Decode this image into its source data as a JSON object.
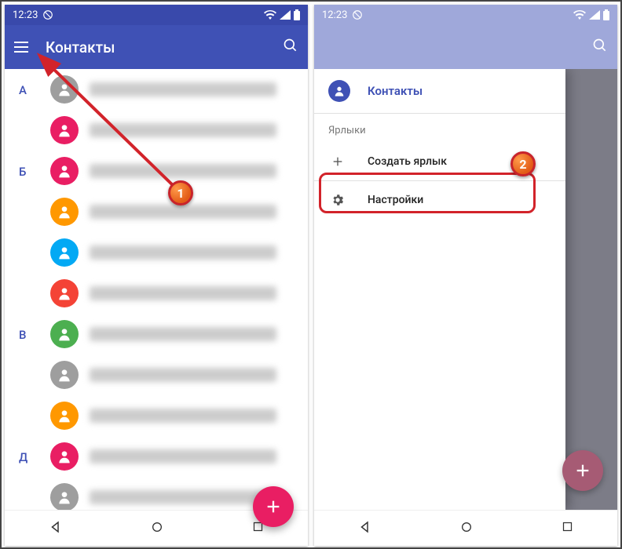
{
  "statusbar": {
    "time": "12:23"
  },
  "phone1": {
    "appbar": {
      "title": "Контакты"
    },
    "sections": [
      {
        "letter": "А",
        "rows": [
          {
            "color": "#9e9e9e"
          },
          {
            "color": "#e91e63"
          }
        ]
      },
      {
        "letter": "Б",
        "rows": [
          {
            "color": "#e91e63"
          },
          {
            "color": "#ff9800"
          },
          {
            "color": "#03a9f4"
          },
          {
            "color": "#f44336"
          }
        ]
      },
      {
        "letter": "В",
        "rows": [
          {
            "color": "#4caf50"
          },
          {
            "color": "#9e9e9e"
          },
          {
            "color": "#ff9800"
          }
        ]
      },
      {
        "letter": "Д",
        "rows": [
          {
            "color": "#e91e63"
          },
          {
            "color": "#9e9e9e"
          }
        ]
      }
    ]
  },
  "phone2": {
    "drawer": {
      "header": "Контакты",
      "section_label": "Ярлыки",
      "create_label": "Создать ярлык",
      "settings_label": "Настройки"
    }
  },
  "annotations": {
    "callout1": "1",
    "callout2": "2"
  }
}
